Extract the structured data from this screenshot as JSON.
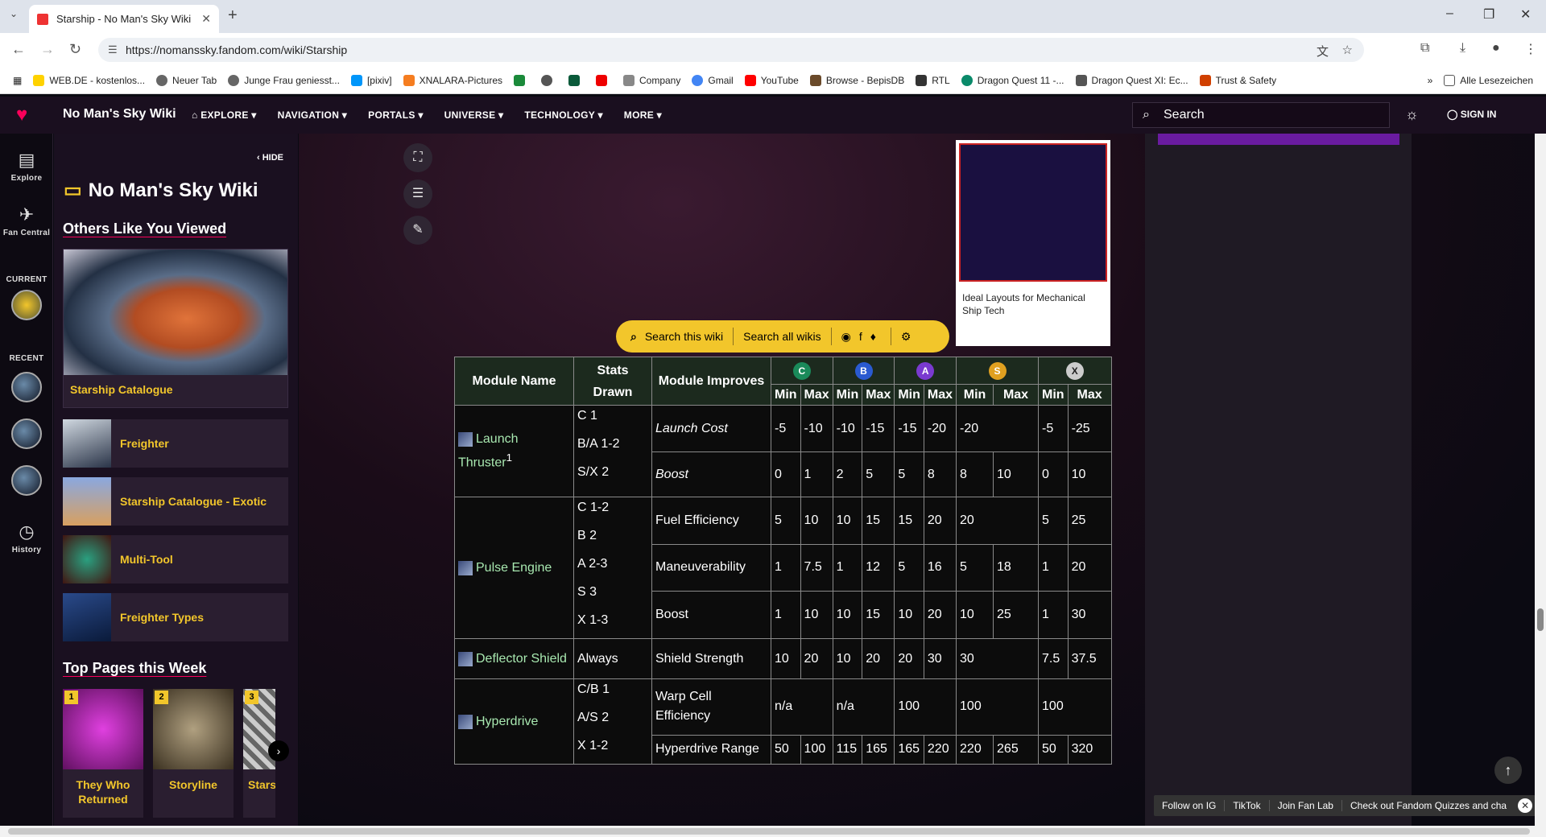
{
  "browser": {
    "tab_title": "Starship - No Man's Sky Wiki",
    "url": "https://nomanssky.fandom.com/wiki/Starship",
    "bookmarks": [
      "WEB.DE - kostenlos...",
      "Neuer Tab",
      "Junge Frau geniesst...",
      "[pixiv]",
      "XNALARA-Pictures",
      "",
      "",
      "",
      "Company",
      "Gmail",
      "YouTube",
      "Browse - BepisDB",
      "RTL",
      "Dragon Quest 11 -...",
      "Dragon Quest XI: Ec...",
      "Trust & Safety"
    ],
    "all_bookmarks": "Alle Lesezeichen",
    "colors": {
      "accent": "#fa005a",
      "yellow": "#f2c62b"
    }
  },
  "header": {
    "wiki_name": "No Man's Sky Wiki",
    "nav": [
      "EXPLORE",
      "NAVIGATION",
      "PORTALS",
      "UNIVERSE",
      "TECHNOLOGY",
      "MORE"
    ],
    "search_placeholder": "Search",
    "sign_in": "SIGN IN"
  },
  "rail": {
    "explore": "Explore",
    "fan_central": "Fan Central",
    "current": "CURRENT",
    "recent": "RECENT",
    "history": "History"
  },
  "panel": {
    "hide": "HIDE",
    "title": "No Man's Sky Wiki",
    "others_heading": "Others Like You Viewed",
    "featured": "Starship Catalogue",
    "items": [
      "Freighter",
      "Starship Catalogue - Exotic",
      "Multi-Tool",
      "Freighter Types"
    ],
    "top_heading": "Top Pages this Week",
    "top_pages": [
      {
        "rank": "1",
        "title": "They Who Returned"
      },
      {
        "rank": "2",
        "title": "Storyline"
      },
      {
        "rank": "3",
        "title": "Stars"
      }
    ]
  },
  "content": {
    "image_caption": "Ideal Layouts for Mechanical Ship Tech",
    "search_this_wiki": "Search this wiki",
    "search_all_wikis": "Search all wikis",
    "table": {
      "headers": {
        "module_name": "Module Name",
        "stats_drawn": "Stats Drawn",
        "module_improves": "Module Improves",
        "min": "Min",
        "max": "Max"
      },
      "classes": [
        "C",
        "B",
        "A",
        "S",
        "X"
      ],
      "rows": [
        {
          "name": "Launch Thruster",
          "sup": "1",
          "stats": [
            "C 1",
            "B/A 1-2",
            "S/X 2"
          ],
          "lines": [
            {
              "improves": "Launch Cost",
              "italic": true,
              "vals": [
                "-5",
                "-10",
                "-10",
                "-15",
                "-15",
                "-20",
                "-20",
                "",
                "-5",
                "-25"
              ]
            },
            {
              "improves": "Boost",
              "italic": true,
              "vals": [
                "0",
                "1",
                "2",
                "5",
                "5",
                "8",
                "8",
                "10",
                "0",
                "10"
              ]
            }
          ]
        },
        {
          "name": "Pulse Engine",
          "sup": "",
          "stats": [
            "C 1-2",
            "B 2",
            "A 2-3",
            "S 3",
            "X 1-3"
          ],
          "lines": [
            {
              "improves": "Fuel Efficiency",
              "italic": false,
              "vals": [
                "5",
                "10",
                "10",
                "15",
                "15",
                "20",
                "20",
                "",
                "5",
                "25"
              ]
            },
            {
              "improves": "Maneuverability",
              "italic": false,
              "vals": [
                "1",
                "7.5",
                "1",
                "12",
                "5",
                "16",
                "5",
                "18",
                "1",
                "20"
              ]
            },
            {
              "improves": "Boost",
              "italic": false,
              "vals": [
                "1",
                "10",
                "10",
                "15",
                "10",
                "20",
                "10",
                "25",
                "1",
                "30"
              ]
            }
          ]
        },
        {
          "name": "Deflector Shield",
          "sup": "",
          "stats": [
            "Always"
          ],
          "lines": [
            {
              "improves": "Shield Strength",
              "italic": false,
              "vals": [
                "10",
                "20",
                "10",
                "20",
                "20",
                "30",
                "30",
                "",
                "7.5",
                "37.5"
              ]
            }
          ]
        },
        {
          "name": "Hyperdrive",
          "sup": "",
          "stats": [
            "C/B 1",
            "A/S 2",
            "X 1-2"
          ],
          "lines": [
            {
              "improves": "Warp Cell Efficiency",
              "italic": false,
              "vals": [
                "n/a",
                "",
                "n/a",
                "",
                "100",
                "",
                "100",
                "",
                "100",
                ""
              ]
            },
            {
              "improves": "Hyperdrive Range",
              "italic": false,
              "vals": [
                "50",
                "100",
                "115",
                "165",
                "165",
                "220",
                "220",
                "265",
                "50",
                "320"
              ]
            }
          ]
        }
      ]
    }
  },
  "footer": {
    "follow_ig": "Follow on IG",
    "tiktok": "TikTok",
    "join_fan_lab": "Join Fan Lab",
    "quizzes": "Check out Fandom Quizzes and cha"
  }
}
